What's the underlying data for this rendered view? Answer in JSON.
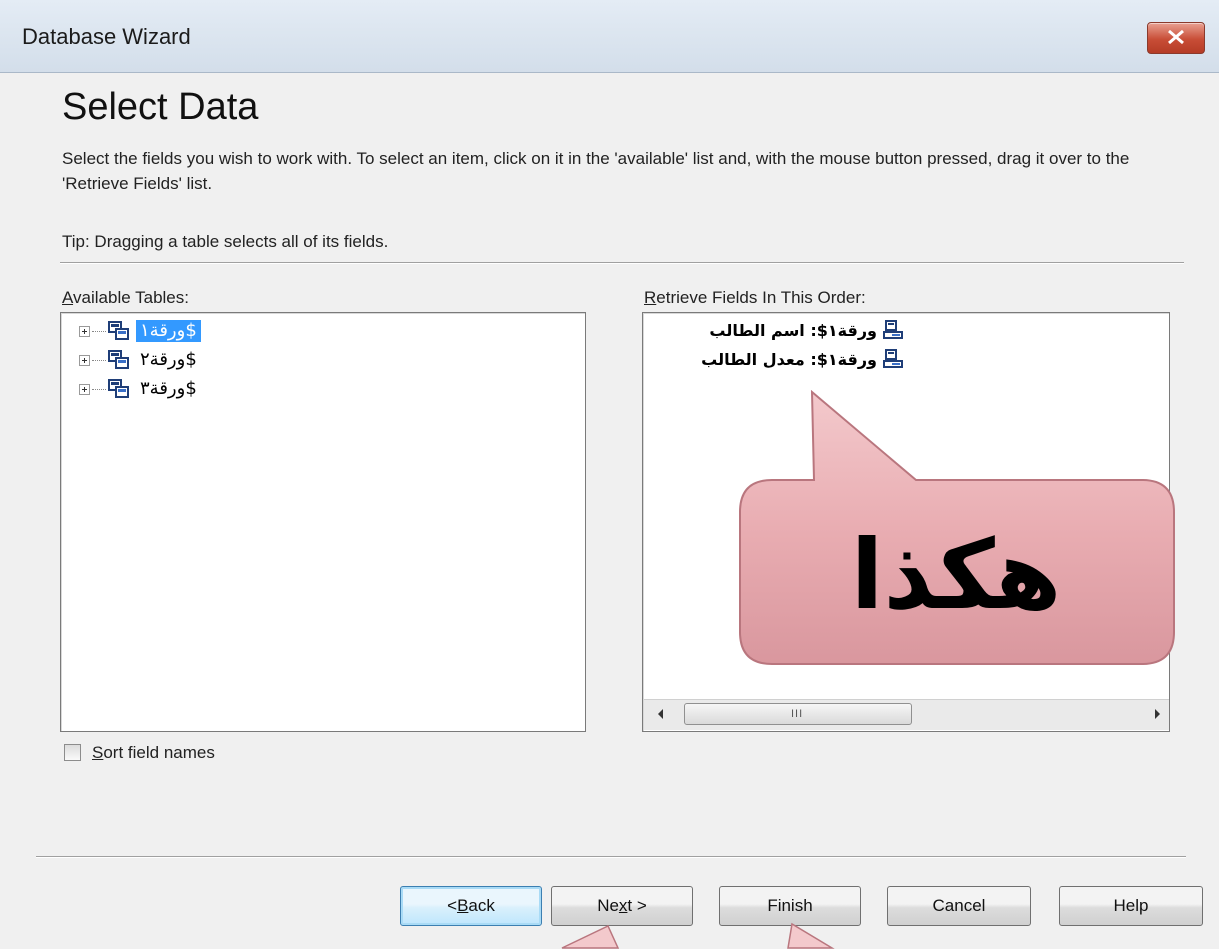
{
  "window": {
    "title": "Database Wizard",
    "close_icon": "close-icon"
  },
  "page": {
    "heading": "Select Data",
    "description": "Select the fields you wish to work with. To select an item, click on it in the 'available' list and, with the mouse button pressed, drag it over to the 'Retrieve Fields' list.",
    "tip": "Tip: Dragging a table selects all of its fields."
  },
  "available_tables": {
    "label_prefix": "A",
    "label_rest": "vailable Tables:",
    "items": [
      {
        "label": "ورقة١$",
        "selected": true
      },
      {
        "label": "ورقة٢$",
        "selected": false
      },
      {
        "label": "ورقة٣$",
        "selected": false
      }
    ]
  },
  "retrieve_fields": {
    "label_prefix": "R",
    "label_rest": "etrieve Fields In This Order:",
    "items": [
      {
        "label": "ورقة١$: اسم الطالب"
      },
      {
        "label": "ورقة١$: معدل الطالب"
      }
    ],
    "scroll_grip": "III"
  },
  "sort_field_names": {
    "prefix": "S",
    "rest": "ort field names",
    "checked": false
  },
  "callout": {
    "text": "هكذا"
  },
  "buttons": {
    "back": {
      "prefix": "< ",
      "mnemonic": "B",
      "rest": "ack"
    },
    "next": {
      "prefix": "Ne",
      "mnemonic": "x",
      "rest": "t >"
    },
    "finish": "Finish",
    "cancel": "Cancel",
    "help": "Help"
  },
  "colors": {
    "selection": "#3399ff",
    "callout_fill": "#e8aab0",
    "close_button": "#c84d36"
  }
}
